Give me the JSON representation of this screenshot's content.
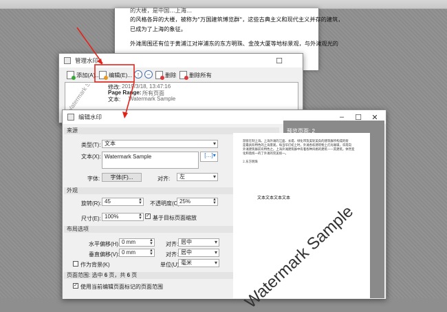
{
  "document": {
    "lines": [
      "的风格各异的大楼，被称为\"万国建筑博览群\"，这些古典主义和现代主义并存的建筑，",
      "已成为了上海的象征。",
      "外滩周围还有位于黄浦江对岸浦东的东方明珠、金茂大厦等地标景观，与外滩观光的"
    ],
    "partial_top_line": "中国…",
    "partial_top_line_full": "的大楼，是中国…上海…"
  },
  "manage_dialog": {
    "title": "管理水印",
    "toolbar": {
      "add_label": "添加(A)...",
      "edit_label": "编辑(E)...",
      "up_symbol": "↑",
      "down_symbol": "−",
      "delete_label": "删除",
      "delete_all_label": "删除所有"
    },
    "list_item": {
      "thumbnail_text": "Watermark Sample",
      "modified_label": "修改:",
      "modified_value": "2019/3/18, 13:47:16",
      "page_range_label": "Page Range:",
      "page_range_value": "所有页面",
      "text_label": "文本:",
      "text_value": "Watermark Sample"
    }
  },
  "edit_dialog": {
    "title": "编辑水印",
    "source": {
      "section": "来源",
      "type_label": "类型(T):",
      "type_value": "文本",
      "text_label": "文本(X):",
      "text_value": "Watermark Sample",
      "font_label": "字体:",
      "font_button": "字体(F)...",
      "align_label": "对齐:",
      "align_value": "左"
    },
    "appearance": {
      "section": "外观",
      "rotation_label": "旋转(R):",
      "rotation_value": "45",
      "opacity_label": "不透明度(O):",
      "opacity_value": "25%",
      "scale_label": "尺寸(E):",
      "scale_value": "100%",
      "relative_scale_label": "基于目标页面缩放",
      "relative_scale_checked": true
    },
    "layout": {
      "section": "布局选项",
      "h_offset_label": "水平偏移(H):",
      "h_offset_value": "0 mm",
      "h_align_label": "对齐:",
      "h_align_value": "居中",
      "v_offset_label": "垂直偏移(V):",
      "v_offset_value": "0 mm",
      "v_align_label": "对齐:",
      "v_align_value": "居中",
      "background_label": "作为背景(K)",
      "background_checked": false,
      "unit_label": "单位(U):",
      "unit_value": "毫米"
    },
    "page_range": {
      "prefix": "页面范围: 选中",
      "selected": "6",
      "middle": "页，共",
      "total": "6",
      "suffix": "页",
      "use_current_label": "使用当前编辑页面标记的页面范围",
      "use_current_checked": true
    },
    "preview": {
      "label": "预览页面: 2",
      "lines": [
        "游客在制上海。上海外滩的江面、长堤、绿化带及美轮美奂的建筑群所构成的街",
        "是最具有特色的上海景观，每当华灯初上时，外滩各栋建筑物上灯光璀璨，华南向",
        "外滩建筑群前有特色之。上海外滩建筑群中有着各种风格的建筑——其建筑，体然变",
        "化和谐统一的了外滩的完美统一。"
      ],
      "small_label": "2.东方明珠",
      "body_text": "文本文本文本文本",
      "watermark": "Watermark Sample"
    }
  },
  "colors": {
    "annotation_red": "#e2231a",
    "accent_blue": "#1e6fd0"
  }
}
